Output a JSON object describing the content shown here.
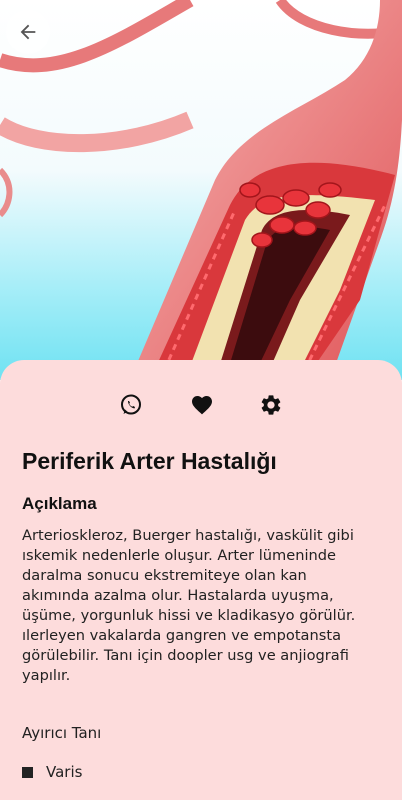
{
  "header": {
    "back_icon": "arrow-left-icon"
  },
  "actions": [
    {
      "name": "whatsapp-share-button",
      "icon": "whatsapp-icon"
    },
    {
      "name": "favorite-button",
      "icon": "heart-icon"
    },
    {
      "name": "settings-button",
      "icon": "gear-icon"
    }
  ],
  "disease": {
    "title": "Periferik Arter Hastalığı",
    "description_heading": "Açıklama",
    "description": "Arterioskleroz, Buerger hastalığı, vaskülit gibi ıskemik nedenlerle oluşur. Arter lümeninde daralma sonucu ekstremiteye olan kan akımında azalma olur. Hastalarda uyuşma, üşüme, yorgunluk hissi ve kladikasyo görülür. ılerleyen vakalarda gangren ve empotansta görülebilir. Tanı için doopler usg ve anjiografi yapılır.",
    "differential_heading": "Ayırıcı Tanı",
    "differential_items": [
      "Varis"
    ]
  },
  "colors": {
    "sheet_background": "#fddcdc",
    "artery_red": "#e8585a",
    "plaque_yellow": "#f2e2b0",
    "sky_cyan": "#7fe6f4"
  }
}
